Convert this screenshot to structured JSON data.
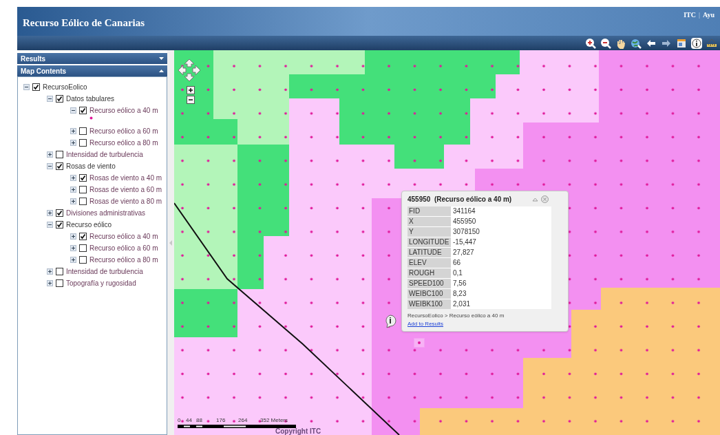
{
  "header": {
    "title": "Recurso Eólico de Canarias",
    "links": [
      "ITC",
      "Ayu"
    ],
    "separator": "|"
  },
  "panels": [
    {
      "title": "Results",
      "expanded": false
    },
    {
      "title": "Map Contents",
      "expanded": true
    }
  ],
  "tree": [
    {
      "label": "RecursoEolico",
      "checked": true,
      "expanded": true,
      "children": [
        {
          "label": "Datos tabulares",
          "checked": true,
          "expanded": true,
          "children": [
            {
              "label": "Recurso eólico a 40 m",
              "checked": true,
              "expanded": true
            },
            {
              "label": "Recurso eólico a 60 m",
              "checked": false,
              "expanded": false
            },
            {
              "label": "Recurso eólico a 80 m",
              "checked": false,
              "expanded": false
            }
          ]
        },
        {
          "label": "Intensidad de turbulencia",
          "checked": false,
          "expanded": false
        },
        {
          "label": "Rosas de viento",
          "checked": true,
          "expanded": true,
          "children": [
            {
              "label": "Rosas de viento a 40 m",
              "checked": true,
              "expanded": false
            },
            {
              "label": "Rosas de viento a 60 m",
              "checked": false,
              "expanded": false
            },
            {
              "label": "Rosas de viento a 80 m",
              "checked": false,
              "expanded": false
            }
          ]
        },
        {
          "label": "Divisiones administrativas",
          "checked": true,
          "expanded": false
        },
        {
          "label": "Recurso eólico",
          "checked": true,
          "expanded": true,
          "children": [
            {
              "label": "Recurso eólico a 40 m",
              "checked": true,
              "expanded": false
            },
            {
              "label": "Recurso eólico a 60 m",
              "checked": false,
              "expanded": false
            },
            {
              "label": "Recurso eólico a 80 m",
              "checked": false,
              "expanded": false
            }
          ]
        },
        {
          "label": "Intensidad de turbulencia",
          "checked": false,
          "expanded": false
        },
        {
          "label": "Topografía y rugosidad",
          "checked": false,
          "expanded": false
        }
      ]
    }
  ],
  "popup": {
    "title": "455950  (Recurso eólico a 40 m)",
    "rows": [
      {
        "field": "FID",
        "value": "341164"
      },
      {
        "field": "X",
        "value": "455950"
      },
      {
        "field": "Y",
        "value": "3078150"
      },
      {
        "field": "LONGITUDE",
        "value": "-15,447"
      },
      {
        "field": "LATITUDE",
        "value": "27,827"
      },
      {
        "field": "ELEV",
        "value": "66"
      },
      {
        "field": "ROUGH",
        "value": "0,1"
      },
      {
        "field": "SPEED100",
        "value": "7,56"
      },
      {
        "field": "WEIBC100",
        "value": "8,23"
      },
      {
        "field": "WEIBK100",
        "value": "2,031"
      }
    ],
    "path": "RecursoEolico > Recurso eólico a 40 m",
    "link": "Add to Results"
  },
  "scale": {
    "labels": [
      "0",
      "44",
      "88",
      "176",
      "264",
      "352 Meters"
    ]
  },
  "copyright": "Copyright ITC"
}
